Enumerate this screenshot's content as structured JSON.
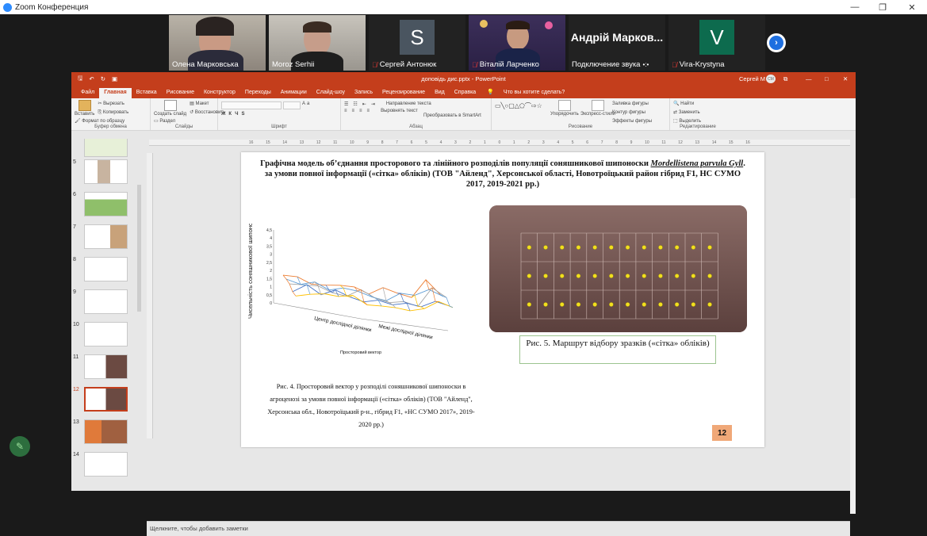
{
  "zoom": {
    "title": "Zoom Конференция",
    "participants": [
      {
        "name": "Олена Марковська",
        "type": "video",
        "muted": false
      },
      {
        "name": "Moroz Serhii",
        "type": "video",
        "muted": false,
        "active": true
      },
      {
        "name": "Сергей Антонюк",
        "type": "avatar",
        "initial": "S",
        "avatar_color": "#4a5560",
        "muted": true
      },
      {
        "name": "Віталій Ларченко",
        "type": "video",
        "muted": true
      },
      {
        "name": "Подключение звука",
        "type": "name",
        "display": "Андрій Марков...",
        "muted": false
      },
      {
        "name": "Vira-Krystyna",
        "type": "avatar",
        "initial": "V",
        "avatar_color": "#0d6b4e",
        "muted": true
      }
    ],
    "next_arrow": "›"
  },
  "ppt": {
    "filename": "доповідь дис.pptx - PowerPoint",
    "user": "Сергей М",
    "user_initials": "СМ",
    "tabs": [
      "Файл",
      "Главная",
      "Вставка",
      "Рисование",
      "Конструктор",
      "Переходы",
      "Анимации",
      "Слайд-шоу",
      "Запись",
      "Рецензирование",
      "Вид",
      "Справка"
    ],
    "selected_tab": "Главная",
    "tell_me": "Что вы хотите сделать?",
    "ribbon": {
      "paste": "Вставить",
      "cut": "Вырезать",
      "copy": "Копировать",
      "format_painter": "Формат по образцу",
      "clipboard": "Буфер обмена",
      "new_slide": "Создать слайд",
      "layout": "Макет",
      "reset": "Восстановить",
      "section": "Раздел",
      "slides": "Слайды",
      "font": "Шрифт",
      "paragraph": "Абзац",
      "text_direction": "Направление текста",
      "align_text": "Выровнять текст",
      "smartart": "Преобразовать в SmartArt",
      "arrange": "Упорядочить",
      "quick_styles": "Экспресс-стили",
      "drawing": "Рисование",
      "shape_fill": "Заливка фигуры",
      "shape_outline": "Контур фигуры",
      "shape_effects": "Эффекты фигуры",
      "find": "Найти",
      "replace": "Заменить",
      "select": "Выделить",
      "editing": "Редактирование"
    },
    "thumbnails": [
      "5",
      "6",
      "7",
      "8",
      "9",
      "10",
      "11",
      "12",
      "13",
      "14"
    ],
    "selected_slide": "12",
    "notes_placeholder": "Щелкните, чтобы добавить заметки",
    "ruler_marks": [
      "16",
      "15",
      "14",
      "13",
      "12",
      "11",
      "10",
      "9",
      "8",
      "7",
      "6",
      "5",
      "4",
      "3",
      "2",
      "1",
      "0",
      "1",
      "2",
      "3",
      "4",
      "5",
      "6",
      "7",
      "8",
      "9",
      "10",
      "11",
      "12",
      "13",
      "14",
      "15",
      "16"
    ]
  },
  "slide": {
    "title_part1": "Графічна модель об’єднання просторового та лінійного розподілів популяції соняшникової шипоноски ",
    "title_species": "Mordellistena parvula Gyll",
    "title_part2": ". за умови повної інформації  («сітка» обліків) (ТОВ \"Айленд\", Херсонської області, Новотроїцький район гібрид F1, НС СУМО 2017, 2019-2021 рр.)",
    "caption4": "Рис. 4. Просторовий вектор у розподілі соняшникової шипоноски в агроценозі за умови повної інформації  («сітка» обліків) (ТОВ \"Айленд\", Херсонська обл., Новотроїцький р-н., гібрид F1, «НС СУМО 2017», 2019-2020 рр.)",
    "caption5": "Рис. 5. Маршрут відбору зразків («сітка» обліків)",
    "page_number": "12"
  },
  "chart_data": {
    "type": "line",
    "ylabel": "Чисельність соняшникової шипоноски, личинок /росл",
    "axis1": "Центр дослідної ділянки",
    "axis2": "Межі дослідної ділянки",
    "xlabel": "Просторовий вектор",
    "yticks": [
      "0",
      "0,5",
      "1",
      "1,5",
      "2",
      "2,5",
      "3",
      "3,5",
      "4",
      "4,5"
    ],
    "ylim": [
      0,
      4.5
    ],
    "series_colors": [
      "#ed7d31",
      "#5b9bd5",
      "#a5a5a5",
      "#4472c4",
      "#ffc000"
    ]
  }
}
